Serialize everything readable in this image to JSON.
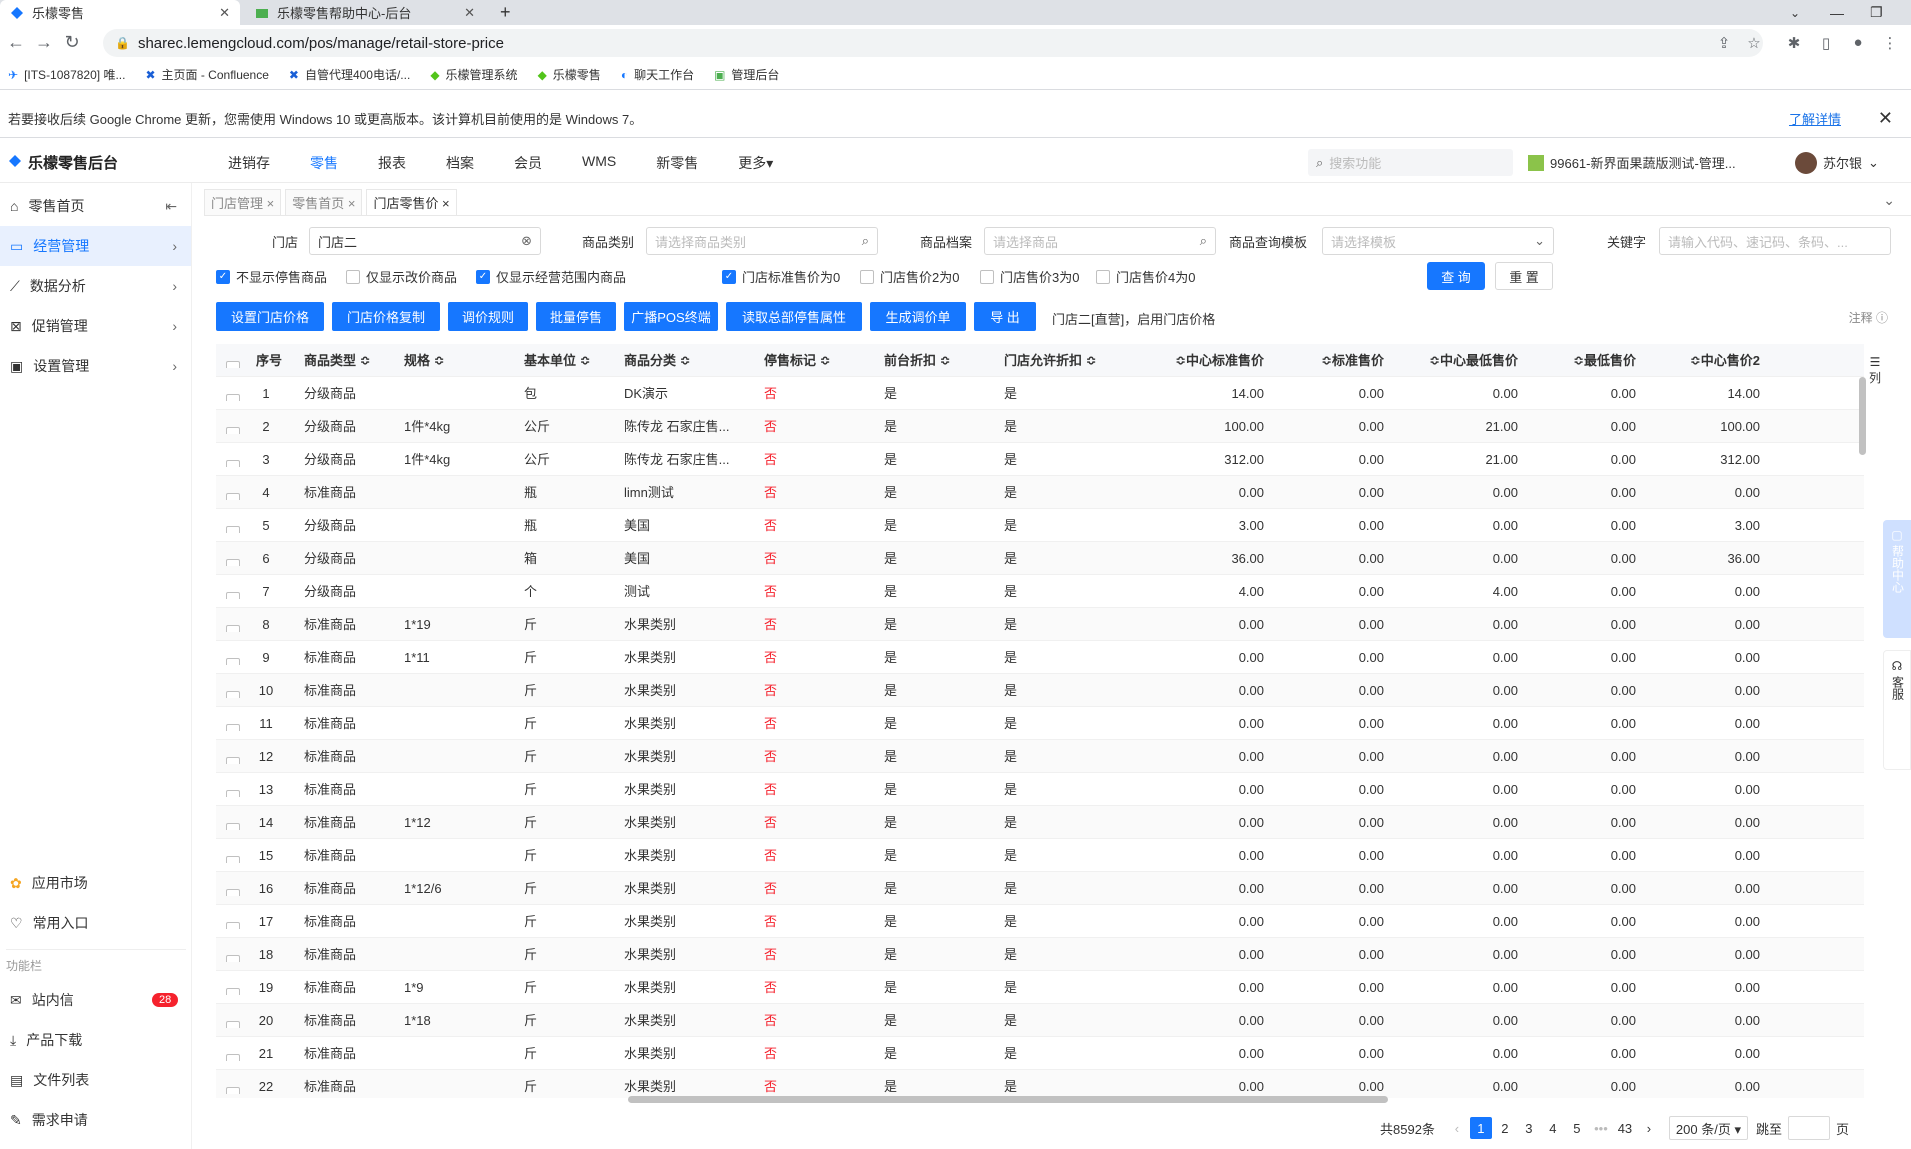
{
  "browser": {
    "tabs": [
      {
        "title": "乐檬零售",
        "active": true
      },
      {
        "title": "乐檬零售帮助中心-后台",
        "active": false
      }
    ],
    "url": "sharec.lemengcloud.com/pos/manage/retail-store-price",
    "bookmarks": [
      "[ITS-1087820] 唯...",
      "主页面 - Confluence",
      "自管代理400电话/...",
      "乐檬管理系统",
      "乐檬零售",
      "聊天工作台",
      "管理后台"
    ],
    "infobar": {
      "text": "若要接收后续 Google Chrome 更新，您需使用 Windows 10 或更高版本。该计算机目前使用的是 Windows 7。",
      "link": "了解详情"
    }
  },
  "app": {
    "logo": "乐檬零售后台",
    "nav": [
      "进销存",
      "零售",
      "报表",
      "档案",
      "会员",
      "WMS",
      "新零售",
      "更多▾"
    ],
    "active_nav": 1,
    "search_placeholder": "搜索功能",
    "store": "99661-新界面果蔬版测试-管理...",
    "user": "苏尔银"
  },
  "sidebar": {
    "items": [
      {
        "label": "零售首页",
        "icon": "home-icon"
      },
      {
        "label": "经营管理",
        "icon": "monitor-icon",
        "active": true
      },
      {
        "label": "数据分析",
        "icon": "chart-icon"
      },
      {
        "label": "促销管理",
        "icon": "promotion-icon"
      },
      {
        "label": "设置管理",
        "icon": "settings-icon"
      }
    ],
    "bottom": [
      {
        "label": "应用市场",
        "icon": "app-market-icon"
      },
      {
        "label": "常用入口",
        "icon": "heart-icon"
      }
    ],
    "group_title": "功能栏",
    "functions": [
      {
        "label": "站内信",
        "icon": "mail-icon",
        "badge": "28"
      },
      {
        "label": "产品下载",
        "icon": "download-icon"
      },
      {
        "label": "文件列表",
        "icon": "file-list-icon"
      },
      {
        "label": "需求申请",
        "icon": "request-icon"
      }
    ]
  },
  "page_tabs": [
    "门店管理 ×",
    "零售首页 ×",
    "门店零售价 ×"
  ],
  "filters": {
    "store_label": "门店",
    "store_value": "门店二",
    "category_label": "商品类别",
    "category_placeholder": "请选择商品类别",
    "archive_label": "商品档案",
    "archive_placeholder": "请选择商品",
    "template_label": "商品查询模板",
    "template_placeholder": "请选择模板",
    "keyword_label": "关键字",
    "keyword_placeholder": "请输入代码、速记码、条码、..."
  },
  "checkboxes": [
    {
      "label": "不显示停售商品",
      "checked": true
    },
    {
      "label": "仅显示改价商品",
      "checked": false
    },
    {
      "label": "仅显示经营范围内商品",
      "checked": true
    },
    {
      "label": "门店标准售价为0",
      "checked": true
    },
    {
      "label": "门店售价2为0",
      "checked": false
    },
    {
      "label": "门店售价3为0",
      "checked": false
    },
    {
      "label": "门店售价4为0",
      "checked": false
    }
  ],
  "query_btn": "查 询",
  "reset_btn": "重 置",
  "actions": [
    "设置门店价格",
    "门店价格复制",
    "调价规则",
    "批量停售",
    "广播POS终端",
    "读取总部停售属性",
    "生成调价单",
    "导 出"
  ],
  "store_info": "门店二[直营]，启用门店价格",
  "note": "注释 ⓘ",
  "column_toggle": "列",
  "table": {
    "headers": [
      "序号",
      "商品类型 ≎",
      "规格 ≎",
      "基本单位 ≎",
      "商品分类 ≎",
      "停售标记 ≎",
      "前台折扣 ≎",
      "门店允许折扣 ≎",
      "≎中心标准售价",
      "≎标准售价",
      "≎中心最低售价",
      "≎最低售价",
      "≎中心售价2"
    ],
    "rows": [
      [
        "1",
        "分级商品",
        "",
        "包",
        "DK演示",
        "否",
        "是",
        "是",
        "14.00",
        "0.00",
        "0.00",
        "0.00",
        "14.00"
      ],
      [
        "2",
        "分级商品",
        "1件*4kg",
        "公斤",
        "陈传龙 石家庄售...",
        "否",
        "是",
        "是",
        "100.00",
        "0.00",
        "21.00",
        "0.00",
        "100.00"
      ],
      [
        "3",
        "分级商品",
        "1件*4kg",
        "公斤",
        "陈传龙 石家庄售...",
        "否",
        "是",
        "是",
        "312.00",
        "0.00",
        "21.00",
        "0.00",
        "312.00"
      ],
      [
        "4",
        "标准商品",
        "",
        "瓶",
        "limn测试",
        "否",
        "是",
        "是",
        "0.00",
        "0.00",
        "0.00",
        "0.00",
        "0.00"
      ],
      [
        "5",
        "分级商品",
        "",
        "瓶",
        "美国",
        "否",
        "是",
        "是",
        "3.00",
        "0.00",
        "0.00",
        "0.00",
        "3.00"
      ],
      [
        "6",
        "分级商品",
        "",
        "箱",
        "美国",
        "否",
        "是",
        "是",
        "36.00",
        "0.00",
        "0.00",
        "0.00",
        "36.00"
      ],
      [
        "7",
        "分级商品",
        "",
        "个",
        "测试",
        "否",
        "是",
        "是",
        "4.00",
        "0.00",
        "4.00",
        "0.00",
        "0.00"
      ],
      [
        "8",
        "标准商品",
        "1*19",
        "斤",
        "水果类别",
        "否",
        "是",
        "是",
        "0.00",
        "0.00",
        "0.00",
        "0.00",
        "0.00"
      ],
      [
        "9",
        "标准商品",
        "1*11",
        "斤",
        "水果类别",
        "否",
        "是",
        "是",
        "0.00",
        "0.00",
        "0.00",
        "0.00",
        "0.00"
      ],
      [
        "10",
        "标准商品",
        "",
        "斤",
        "水果类别",
        "否",
        "是",
        "是",
        "0.00",
        "0.00",
        "0.00",
        "0.00",
        "0.00"
      ],
      [
        "11",
        "标准商品",
        "",
        "斤",
        "水果类别",
        "否",
        "是",
        "是",
        "0.00",
        "0.00",
        "0.00",
        "0.00",
        "0.00"
      ],
      [
        "12",
        "标准商品",
        "",
        "斤",
        "水果类别",
        "否",
        "是",
        "是",
        "0.00",
        "0.00",
        "0.00",
        "0.00",
        "0.00"
      ],
      [
        "13",
        "标准商品",
        "",
        "斤",
        "水果类别",
        "否",
        "是",
        "是",
        "0.00",
        "0.00",
        "0.00",
        "0.00",
        "0.00"
      ],
      [
        "14",
        "标准商品",
        "1*12",
        "斤",
        "水果类别",
        "否",
        "是",
        "是",
        "0.00",
        "0.00",
        "0.00",
        "0.00",
        "0.00"
      ],
      [
        "15",
        "标准商品",
        "",
        "斤",
        "水果类别",
        "否",
        "是",
        "是",
        "0.00",
        "0.00",
        "0.00",
        "0.00",
        "0.00"
      ],
      [
        "16",
        "标准商品",
        "1*12/6",
        "斤",
        "水果类别",
        "否",
        "是",
        "是",
        "0.00",
        "0.00",
        "0.00",
        "0.00",
        "0.00"
      ],
      [
        "17",
        "标准商品",
        "",
        "斤",
        "水果类别",
        "否",
        "是",
        "是",
        "0.00",
        "0.00",
        "0.00",
        "0.00",
        "0.00"
      ],
      [
        "18",
        "标准商品",
        "",
        "斤",
        "水果类别",
        "否",
        "是",
        "是",
        "0.00",
        "0.00",
        "0.00",
        "0.00",
        "0.00"
      ],
      [
        "19",
        "标准商品",
        "1*9",
        "斤",
        "水果类别",
        "否",
        "是",
        "是",
        "0.00",
        "0.00",
        "0.00",
        "0.00",
        "0.00"
      ],
      [
        "20",
        "标准商品",
        "1*18",
        "斤",
        "水果类别",
        "否",
        "是",
        "是",
        "0.00",
        "0.00",
        "0.00",
        "0.00",
        "0.00"
      ],
      [
        "21",
        "标准商品",
        "",
        "斤",
        "水果类别",
        "否",
        "是",
        "是",
        "0.00",
        "0.00",
        "0.00",
        "0.00",
        "0.00"
      ],
      [
        "22",
        "标准商品",
        "",
        "斤",
        "水果类别",
        "否",
        "是",
        "是",
        "0.00",
        "0.00",
        "0.00",
        "0.00",
        "0.00"
      ]
    ]
  },
  "floating": {
    "help": "帮助中心",
    "service": "客服"
  },
  "pagination": {
    "total": "共8592条",
    "pages": [
      "1",
      "2",
      "3",
      "4",
      "5",
      "•••",
      "43"
    ],
    "current": "1",
    "page_size": "200 条/页 ▾",
    "jump_label": "跳至",
    "page_suffix": "页"
  }
}
